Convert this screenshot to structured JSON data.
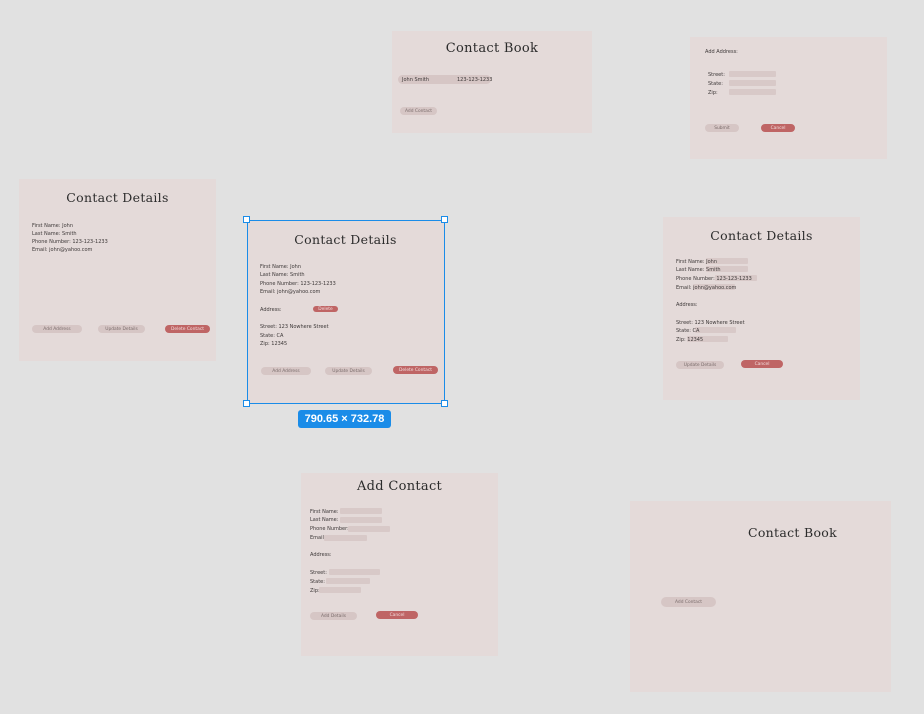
{
  "contact_book_list": {
    "title": "Contact Book",
    "row": "John Smith",
    "row_phone": "123-123-1233",
    "add_button": "Add Contact"
  },
  "add_address": {
    "header": "Add Address:",
    "street_label": "Street:",
    "state_label": "State:",
    "zip_label": "Zip:",
    "submit_button": "Submit",
    "cancel_button": "Cancel"
  },
  "details_left": {
    "title": "Contact Details",
    "first": "First Name: John",
    "last": "Last Name: Smith",
    "phone": "Phone Number: 123-123-1233",
    "email": "Email: john@yahoo.com",
    "add_address": "Add Address",
    "update": "Update Details",
    "delete": "Delete Contact"
  },
  "details_selected": {
    "title": "Contact Details",
    "first": "First Name: John",
    "last": "Last Name: Smith",
    "phone": "Phone Number: 123-123-1233",
    "email": "Email: john@yahoo.com",
    "address_label": "Address:",
    "delete_address": "Delete",
    "street": "Street: 123 Nowhere Street",
    "state": "State: CA",
    "zip": "Zip: 12345",
    "add_address": "Add Address",
    "update": "Update Details",
    "delete": "Delete Contact",
    "dimensions": "790.65 × 732.78"
  },
  "details_edit": {
    "title": "Contact Details",
    "first": "First Name: John",
    "last": "Last Name: Smith",
    "phone": "Phone Number: 123-123-1233",
    "email": "Email: john@yahoo.com",
    "address_label": "Address:",
    "street": "Street: 123 Nowhere Street",
    "state": "State: CA",
    "zip": "Zip: 12345",
    "update": "Update Details",
    "cancel": "Cancel"
  },
  "add_contact": {
    "title": "Add Contact",
    "first": "First Name:",
    "last": "Last Name:",
    "phone": "Phone Number:",
    "email": "Email:",
    "address_label": "Address:",
    "street": "Street:",
    "state": "State:",
    "zip": "Zip:",
    "add_button": "Add Details",
    "cancel": "Cancel"
  },
  "contact_book_empty": {
    "title": "Contact Book",
    "add_button": "Add Contact"
  },
  "colors": {
    "canvas": "#e1e1e1",
    "frame": "#e4dad9",
    "accent_red": "#bf6565",
    "selection_blue": "#1a8ce8"
  }
}
